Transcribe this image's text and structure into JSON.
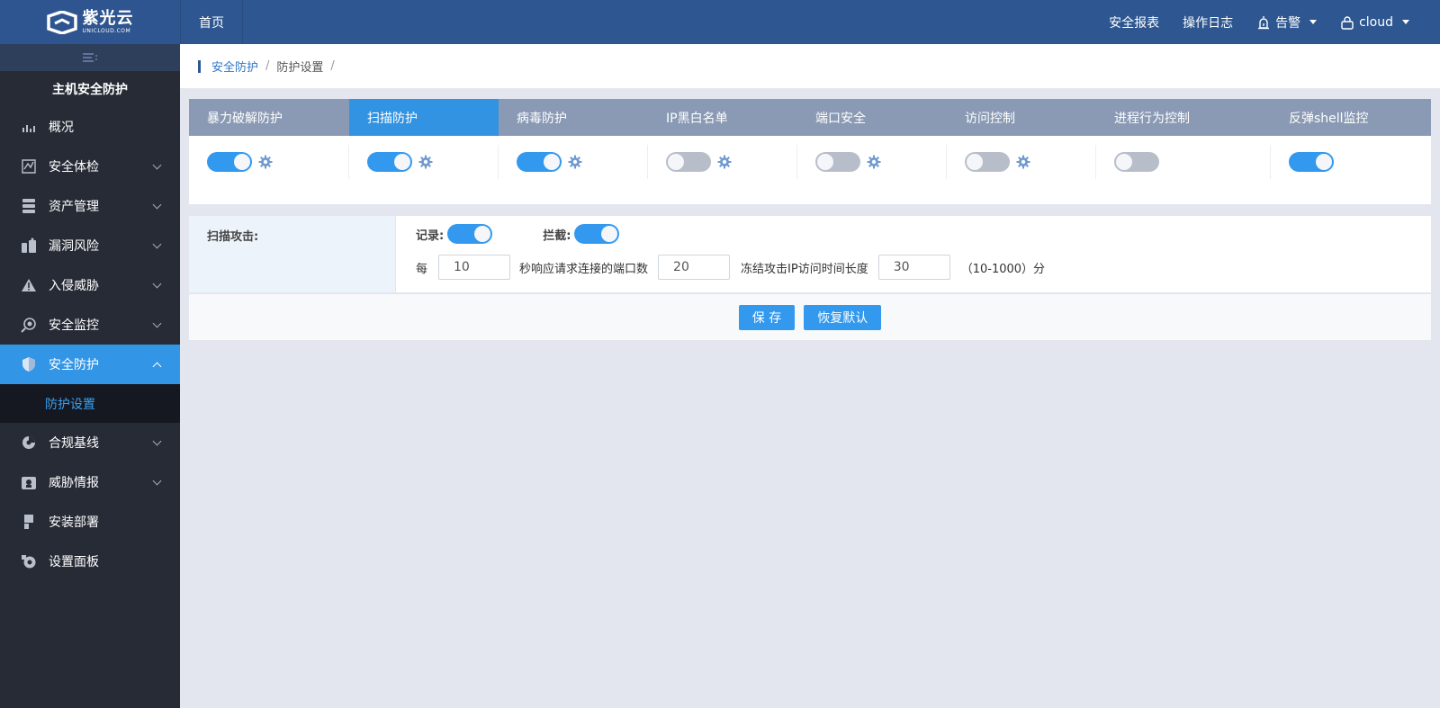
{
  "brand": {
    "name": "紫光云",
    "sub": "UNICLOUD.COM"
  },
  "topnav": {
    "home": "首页",
    "report": "安全报表",
    "oplog": "操作日志",
    "alarm": "告警",
    "user": "cloud"
  },
  "sidebar": {
    "title": "主机安全防护",
    "items": [
      {
        "label": "概况",
        "icon": "chart-icon"
      },
      {
        "label": "安全体检",
        "icon": "scan-check-icon"
      },
      {
        "label": "资产管理",
        "icon": "database-icon"
      },
      {
        "label": "漏洞风险",
        "icon": "bug-icon"
      },
      {
        "label": "入侵威胁",
        "icon": "warning-icon"
      },
      {
        "label": "安全监控",
        "icon": "monitor-icon"
      },
      {
        "label": "安全防护",
        "icon": "shield-icon"
      },
      {
        "label": "合规基线",
        "icon": "baseline-icon"
      },
      {
        "label": "威胁情报",
        "icon": "intel-icon"
      },
      {
        "label": "安装部署",
        "icon": "deploy-icon"
      },
      {
        "label": "设置面板",
        "icon": "settings-icon"
      }
    ],
    "sub_active": "防护设置"
  },
  "breadcrumb": {
    "parent": "安全防护",
    "current": "防护设置",
    "sep": "/"
  },
  "tabs": [
    {
      "label": "暴力破解防护",
      "enabled": true,
      "has_settings": true
    },
    {
      "label": "扫描防护",
      "enabled": true,
      "has_settings": true
    },
    {
      "label": "病毒防护",
      "enabled": true,
      "has_settings": true
    },
    {
      "label": "IP黑白名单",
      "enabled": false,
      "has_settings": true
    },
    {
      "label": "端口安全",
      "enabled": false,
      "has_settings": true
    },
    {
      "label": "访问控制",
      "enabled": false,
      "has_settings": true
    },
    {
      "label": "进程行为控制",
      "enabled": false,
      "has_settings": false
    },
    {
      "label": "反弹shell监控",
      "enabled": true,
      "has_settings": false
    }
  ],
  "active_tab": "扫描防护",
  "scan": {
    "label": "扫描攻击:",
    "record_label": "记录:",
    "record_on": true,
    "block_label": "拦截:",
    "block_on": true,
    "per_label": "每",
    "seconds_value": "10",
    "ports_label": "秒响应请求连接的端口数",
    "ports_value": "20",
    "freeze_label": "冻结攻击IP访问时间长度",
    "freeze_value": "30",
    "range_label": "（10-1000）分"
  },
  "buttons": {
    "save": "保 存",
    "restore": "恢复默认"
  },
  "colors": {
    "header": "#2e5791",
    "sidebar": "#262b36",
    "accent": "#3399ee",
    "tabbar": "#8a9ab4"
  }
}
